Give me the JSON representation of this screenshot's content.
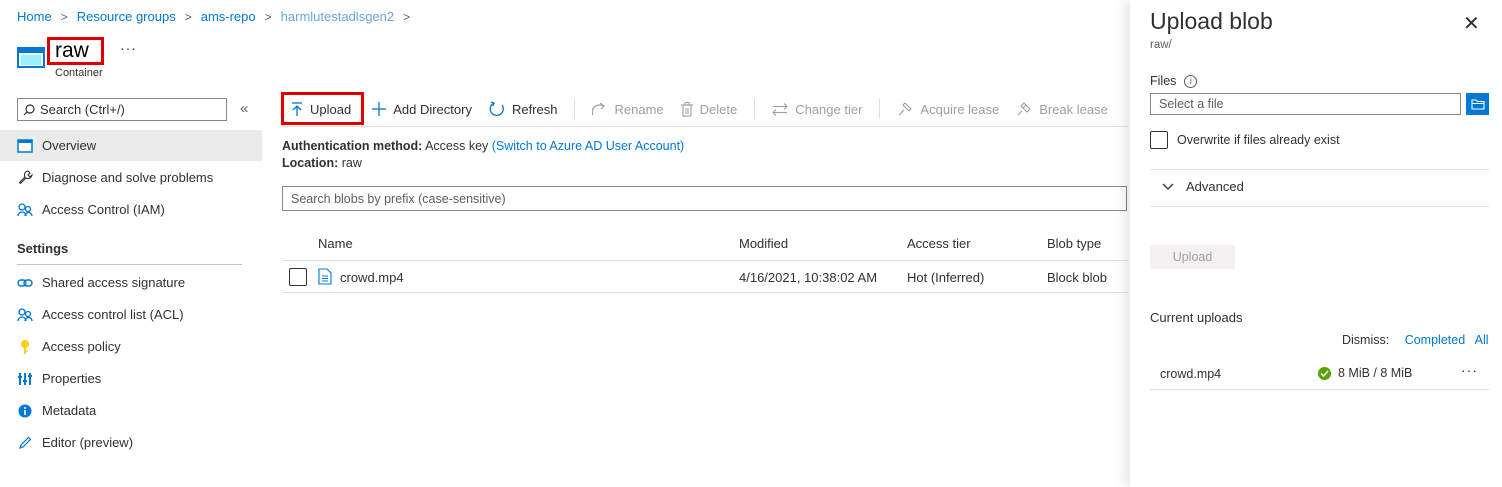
{
  "breadcrumb": {
    "items": [
      "Home",
      "Resource groups",
      "ams-repo",
      "harmlutestadlsgen2"
    ]
  },
  "header": {
    "title": "raw",
    "more": "···",
    "subtitle": "Container"
  },
  "sidebar": {
    "search_placeholder": "Search (Ctrl+/)",
    "collapse": "«",
    "items": [
      {
        "label": "Overview",
        "icon": "overview-icon"
      },
      {
        "label": "Diagnose and solve problems",
        "icon": "wrench-icon"
      },
      {
        "label": "Access Control (IAM)",
        "icon": "people-icon"
      }
    ],
    "settings_label": "Settings",
    "settings_items": [
      {
        "label": "Shared access signature",
        "icon": "link-icon"
      },
      {
        "label": "Access control list (ACL)",
        "icon": "people-icon"
      },
      {
        "label": "Access policy",
        "icon": "key-icon"
      },
      {
        "label": "Properties",
        "icon": "properties-icon"
      },
      {
        "label": "Metadata",
        "icon": "info-icon"
      },
      {
        "label": "Editor (preview)",
        "icon": "pencil-icon"
      }
    ]
  },
  "toolbar": {
    "upload": "Upload",
    "add_directory": "Add Directory",
    "refresh": "Refresh",
    "rename": "Rename",
    "delete": "Delete",
    "change_tier": "Change tier",
    "acquire_lease": "Acquire lease",
    "break_lease": "Break lease"
  },
  "info": {
    "auth_label": "Authentication method:",
    "auth_value": "Access key",
    "auth_link": "(Switch to Azure AD User Account)",
    "location_label": "Location:",
    "location_value": "raw"
  },
  "blob_search": {
    "placeholder": "Search blobs by prefix (case-sensitive)"
  },
  "table": {
    "columns": [
      "Name",
      "Modified",
      "Access tier",
      "Blob type"
    ],
    "rows": [
      {
        "name": "crowd.mp4",
        "modified": "4/16/2021, 10:38:02 AM",
        "access_tier": "Hot (Inferred)",
        "blob_type": "Block blob"
      }
    ]
  },
  "panel": {
    "title": "Upload blob",
    "subtitle": "raw/",
    "close": "✕",
    "files_label": "Files",
    "file_placeholder": "Select a file",
    "overwrite_label": "Overwrite if files already exist",
    "advanced_label": "Advanced",
    "upload_button": "Upload",
    "current_uploads": "Current uploads",
    "dismiss_label": "Dismiss:",
    "dismiss_completed": "Completed",
    "dismiss_all": "All",
    "uploads": [
      {
        "name": "crowd.mp4",
        "status": "8 MiB / 8 MiB",
        "more": "···"
      }
    ]
  },
  "colors": {
    "accent": "#0078d4",
    "highlight": "#e00000",
    "success": "#57a300"
  }
}
